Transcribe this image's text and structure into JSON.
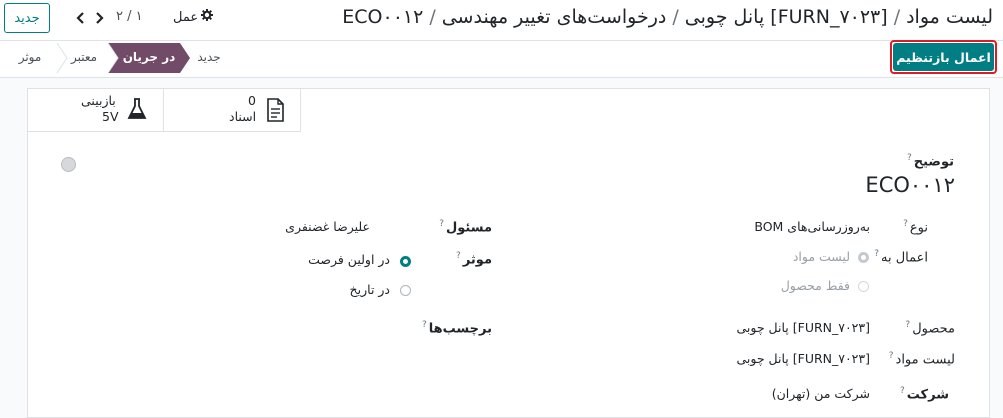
{
  "header": {
    "new_button": "جدید",
    "pager": "۲ / ۱",
    "action_label": "عمل",
    "breadcrumb": [
      "لیست مواد",
      "[FURN_۷۰۲۳] پانل چوبی",
      "درخواست‌های تغییر مهندسی",
      "ECO۰۰۱۲"
    ]
  },
  "statusbar": {
    "apply_button": "اعمال بازتنظیم",
    "stages": [
      "جدید",
      "در جریان",
      "معتبر",
      "موثر"
    ],
    "active_stage": "در جریان"
  },
  "smart_buttons": {
    "documents": {
      "value": "0",
      "label": "اسناد"
    },
    "revision": {
      "label": "بازبینی",
      "value": "5V"
    }
  },
  "form": {
    "description_label": "توضیح",
    "description_value": "ECO۰۰۱۲",
    "type_label": "نوع",
    "type_value": "به‌روزرسانی‌های BOM",
    "apply_on_label": "اعمال به",
    "apply_on_options": [
      "لیست مواد",
      "فقط محصول"
    ],
    "product_label": "محصول",
    "product_value": "[FURN_۷۰۲۳] پانل چوبی",
    "bom_label": "لیست مواد",
    "bom_value": "[FURN_۷۰۲۳] پانل چوبی",
    "company_label": "شرکت",
    "company_value": "شرکت من (تهران)",
    "responsible_label": "مسئول",
    "responsible_value": "علیرضا غضنفری",
    "effective_label": "موثر",
    "effective_options": [
      "در اولین فرصت",
      "در تاریخ"
    ],
    "tags_label": "برچسب‌ها",
    "help_mark": "?"
  },
  "colors": {
    "primary": "#017e84",
    "stage_active": "#714b67",
    "highlight": "#e01b24"
  }
}
